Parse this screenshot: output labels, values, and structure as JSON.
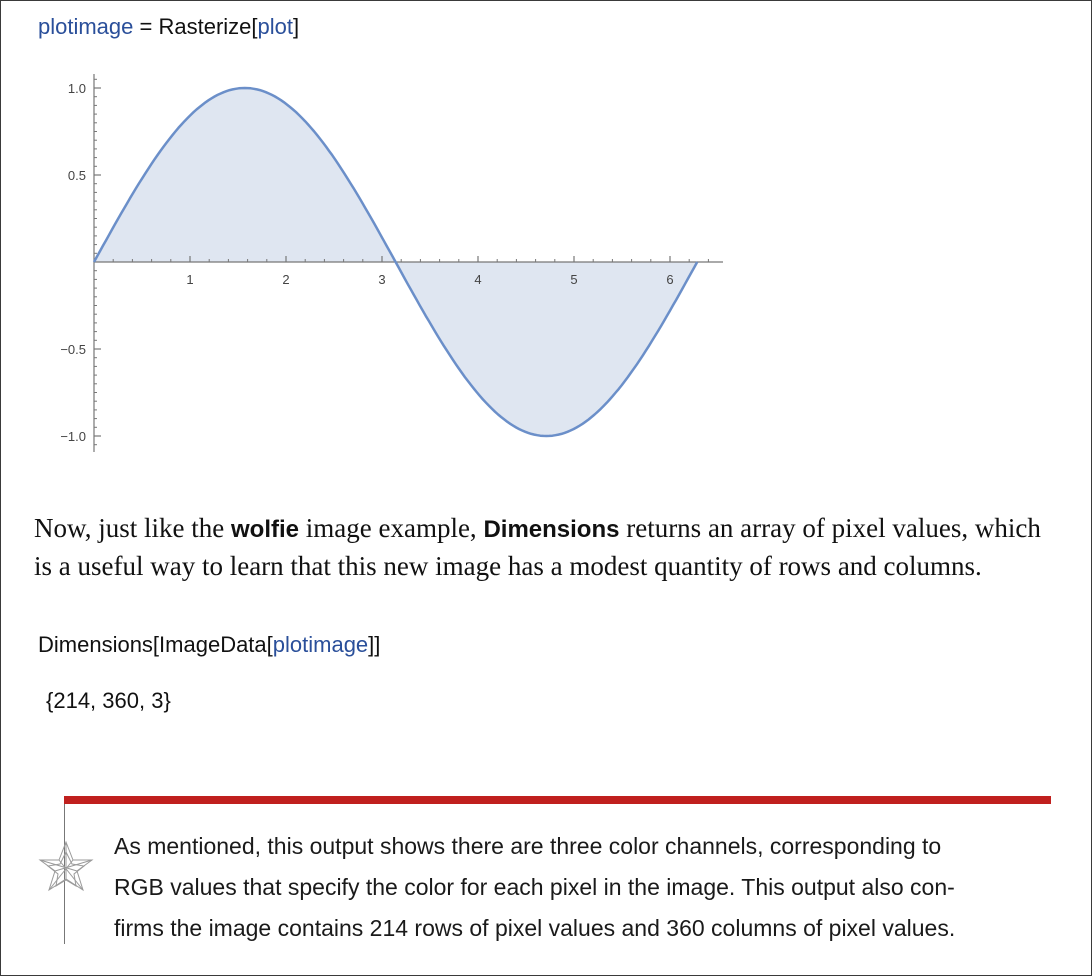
{
  "code1": {
    "var": "plotimage",
    "eq": " = ",
    "fn": "Rasterize[",
    "arg": "plot",
    "close": "]"
  },
  "chart_data": {
    "type": "area",
    "series": [
      {
        "function": "sin(x)",
        "x_range": [
          0,
          6.283
        ]
      }
    ],
    "x_ticks": [
      1,
      2,
      3,
      4,
      5,
      6
    ],
    "y_ticks": [
      1.0,
      0.5,
      -0.5,
      -1.0
    ],
    "x_tick_labels": [
      "1",
      "2",
      "3",
      "4",
      "5",
      "6"
    ],
    "y_tick_labels": [
      "1.0",
      "0.5",
      "−0.5",
      "−1.0"
    ],
    "xlim": [
      0,
      6.5
    ],
    "ylim": [
      -1.0,
      1.0
    ],
    "colors": {
      "line": "#6b8fc9",
      "fill": "#dfe6f1",
      "axis": "#777777"
    }
  },
  "paragraph": {
    "t1": "Now, just like the ",
    "b1": "wolfie",
    "t2": " image example, ",
    "b2": "Dimensions",
    "t3": " returns an array of pixel values, which",
    "t4": "is a useful way to learn that this new image has a modest quantity of rows and columns."
  },
  "code2": {
    "fn": "Dimensions[ImageData[",
    "arg": "plotimage",
    "close": "]]"
  },
  "output": "{214, 360, 3}",
  "note": {
    "lines": [
      "As mentioned, this output shows there are three color channels, corresponding to",
      "RGB values that specify the color for each pixel in the image. This output also con-",
      "firms the image contains 214 rows of pixel values and 360 columns of pixel values."
    ],
    "accent": "#c0201e"
  }
}
